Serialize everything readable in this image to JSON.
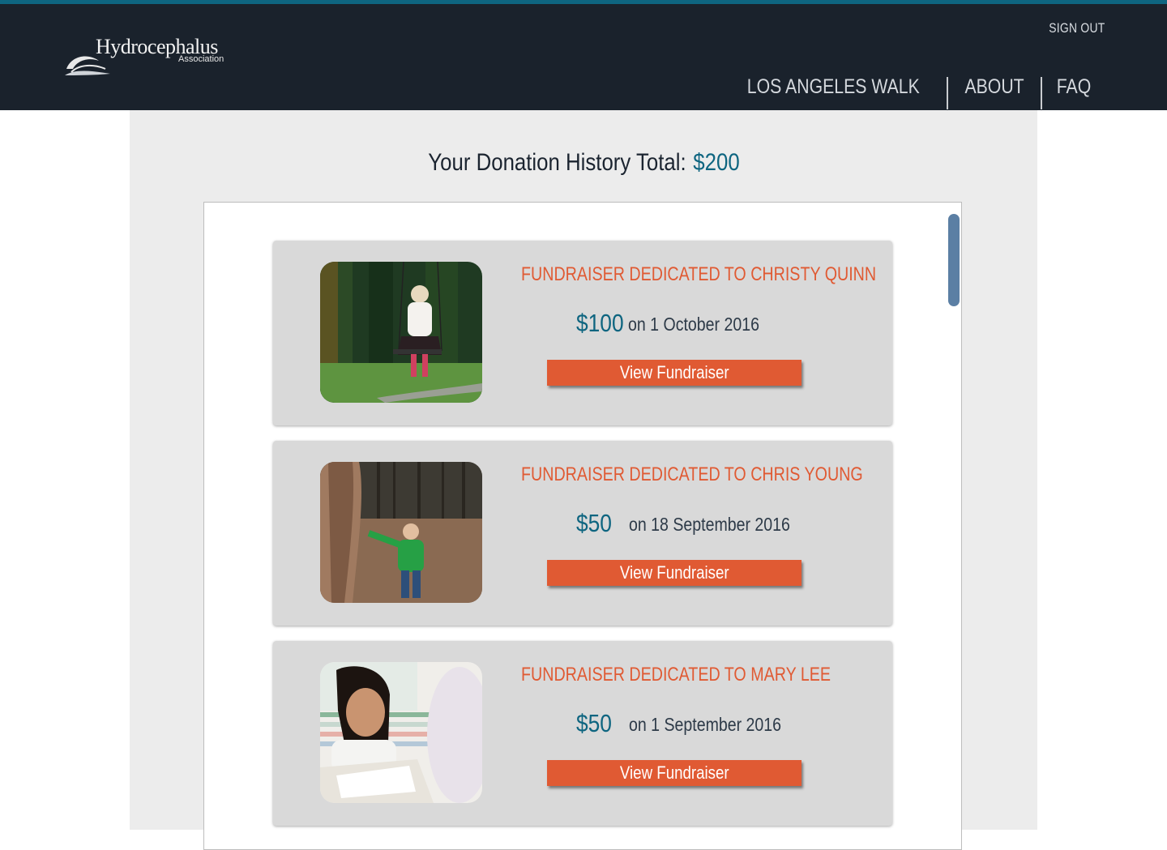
{
  "header": {
    "logo_title": "Hydrocephalus",
    "logo_subtitle": "Association",
    "sign_out": "SIGN OUT",
    "nav": [
      "LOS ANGELES WALK",
      "ABOUT",
      "FAQ"
    ]
  },
  "summary": {
    "label": "Your Donation History Total:",
    "total": "$200"
  },
  "donations": [
    {
      "title": "FUNDRAISER DEDICATED TO CHRISTY QUINN",
      "amount": "$100",
      "date": "on 1 October 2016",
      "button": "View Fundraiser",
      "photo": "girl-on-swing-photo"
    },
    {
      "title": "FUNDRAISER DEDICATED TO CHRIS YOUNG",
      "amount": "$50",
      "date": "on 18 September 2016",
      "button": "View Fundraiser",
      "photo": "boy-by-tree-photo"
    },
    {
      "title": "FUNDRAISER DEDICATED TO MARY LEE",
      "amount": "$50",
      "date": "on 1 September  2016",
      "button": "View Fundraiser",
      "photo": "girl-studying-photo"
    }
  ],
  "colors": {
    "header_bg": "#1a222c",
    "accent_top": "#0e6580",
    "orange": "#e05a33",
    "teal": "#0e6580",
    "card_bg": "#d9d9d9",
    "panel_bg": "#ececec",
    "scrollbar": "#5b7fa4"
  }
}
